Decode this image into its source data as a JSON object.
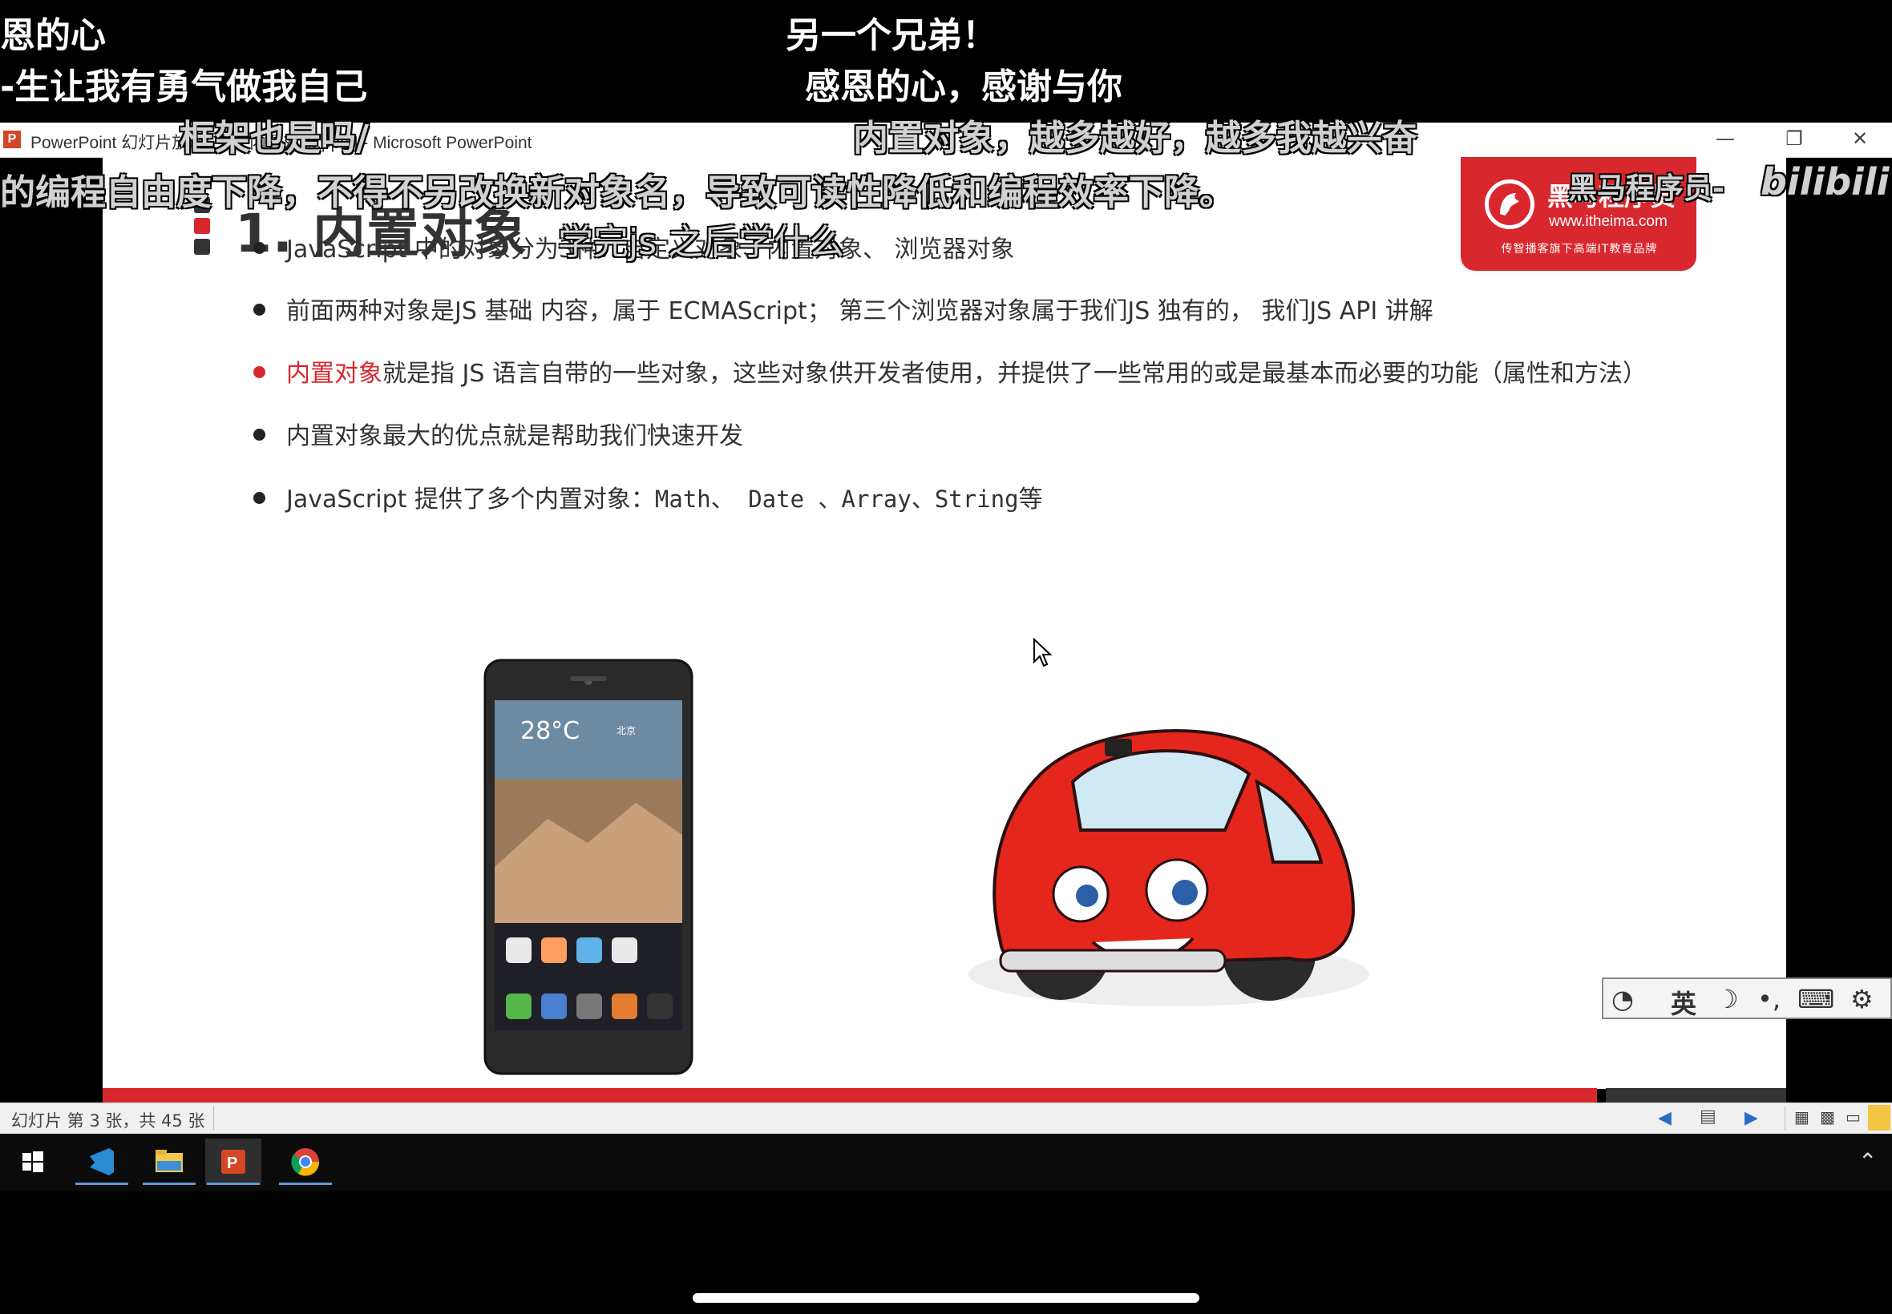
{
  "window": {
    "title": "PowerPoint 幻灯片放映 - [03-内置对象.pptx] - Microsoft PowerPoint",
    "app_icon": "P",
    "minimize": "—",
    "restore": "❐",
    "close": "✕"
  },
  "slide": {
    "title": "1. 内置对象",
    "logo": {
      "name": "黑马程序员",
      "url": "www.itheima.com",
      "tagline": "传智播客旗下高端IT教育品牌"
    },
    "bullets": [
      {
        "text": "JavaScript 中的对象分为3种：自定义对象、内置对象、 浏览器对象"
      },
      {
        "text": "前面两种对象是JS 基础 内容，属于 ECMAScript；  第三个浏览器对象属于我们JS 独有的， 我们JS API 讲解"
      },
      {
        "highlight": "内置对象",
        "text": "就是指 JS 语言自带的一些对象，这些对象供开发者使用，并提供了一些常用的或是最基本而必要的功能（属性和方法）"
      },
      {
        "text": "内置对象最大的优点就是帮助我们快速开发"
      },
      {
        "prefix": "JavaScript 提供了多个内置对象：",
        "code": "Math、 Date 、Array、String",
        "suffix": "等"
      }
    ],
    "phone": {
      "temp": "28°C",
      "city": "北京"
    }
  },
  "statusbar": {
    "slide_info": "幻灯片 第 3 张，共 45 张"
  },
  "ime": {
    "lang": "英",
    "items": [
      "ime-logo-icon",
      "moon-icon",
      "punctuation-icon",
      "keyboard-icon",
      "gear-icon"
    ]
  },
  "danmaku": [
    {
      "text": "恩的心"
    },
    {
      "text": "另一个兄弟！"
    },
    {
      "text": "-生让我有勇气做我自己"
    },
    {
      "text": "感恩的心，感谢与你"
    },
    {
      "text": "框架也是吗/"
    },
    {
      "text": "内置对象，越多越好，越多我越兴奋"
    },
    {
      "text": "的编程自由度下降，不得不另改换新对象名，导致可读性降低和编程效率下降。"
    },
    {
      "text": "学完js 之后学什么"
    }
  ],
  "watermark": {
    "site": "bilibili",
    "channel": "黑马程序员-"
  },
  "colors": {
    "accent": "#d9272e",
    "taskbar": "#0b0b0b",
    "background": "#000000"
  }
}
